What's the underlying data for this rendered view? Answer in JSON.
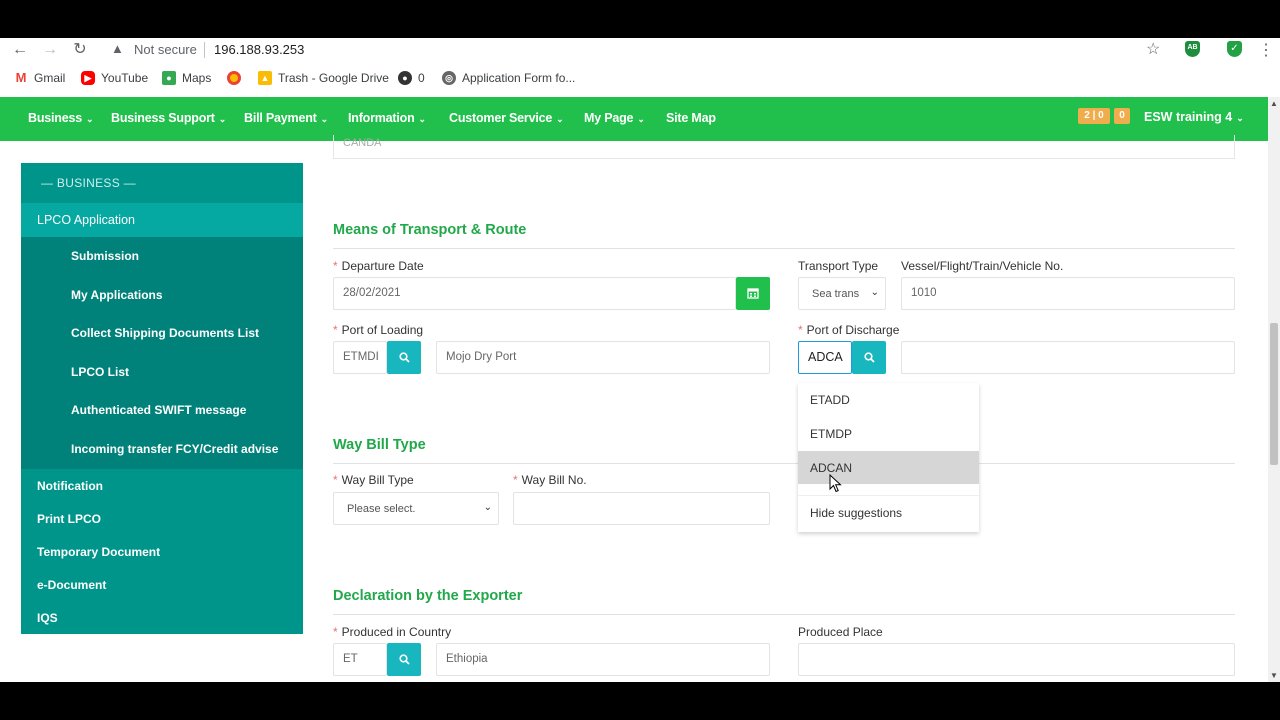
{
  "browser": {
    "security_label": "Not secure",
    "url": "196.188.93.253",
    "bookmarks": [
      {
        "label": "Gmail",
        "icon": "gmail-icon"
      },
      {
        "label": "YouTube",
        "icon": "youtube-icon"
      },
      {
        "label": "Maps",
        "icon": "maps-icon"
      },
      {
        "label": "",
        "icon": "chrome-icon"
      },
      {
        "label": "Trash - Google Drive",
        "icon": "drive-icon"
      },
      {
        "label": "0",
        "icon": "github-icon"
      },
      {
        "label": "Application Form fo...",
        "icon": "globe-icon"
      }
    ],
    "extension_1_label": "AB"
  },
  "nav": {
    "items": [
      "Business",
      "Business Support",
      "Bill Payment",
      "Information",
      "Customer Service",
      "My Page",
      "Site Map"
    ],
    "counter_1": "2 | 0",
    "counter_2": "0",
    "user": "ESW training 4"
  },
  "sidebar": {
    "header": "— BUSINESS —",
    "active": "LPCO Application",
    "sub_items": [
      "Submission",
      "My Applications",
      "Collect Shipping Documents List",
      "LPCO List",
      "Authenticated SWIFT message",
      "Incoming transfer FCY/Credit advise"
    ],
    "items": [
      "Notification",
      "Print LPCO",
      "Temporary Document",
      "e-Document",
      "IQS"
    ]
  },
  "form": {
    "prev_field_value": "CANDA",
    "transport": {
      "title": "Means of Transport & Route",
      "departure_date_label": "Departure Date",
      "departure_date_value": "28/02/2021",
      "transport_type_label": "Transport Type",
      "transport_type_value": "Sea trans",
      "vessel_label": "Vessel/Flight/Train/Vehicle No.",
      "vessel_value": "1010",
      "port_loading_label": "Port of Loading",
      "port_loading_code": "ETMDI",
      "port_loading_name": "Mojo Dry Port",
      "port_discharge_label": "Port of Discharge",
      "port_discharge_code": "ADCA",
      "port_discharge_name": ""
    },
    "waybill": {
      "title": "Way Bill Type",
      "type_label": "Way Bill Type",
      "type_placeholder": "Please select.",
      "no_label": "Way Bill No.",
      "no_value": ""
    },
    "declaration": {
      "title": "Declaration by the Exporter",
      "country_label": "Produced in Country",
      "country_code": "ET",
      "country_name": "Ethiopia",
      "place_label": "Produced Place",
      "place_value": ""
    }
  },
  "suggestions": {
    "items": [
      "ETADD",
      "ETMDP",
      "ADCAN"
    ],
    "highlighted": "ADCAN",
    "hide_label": "Hide suggestions"
  },
  "colors": {
    "nav_green": "#21c04d",
    "sidebar_teal": "#00958b",
    "section_title": "#21a84a",
    "search_btn": "#18b6bf"
  }
}
